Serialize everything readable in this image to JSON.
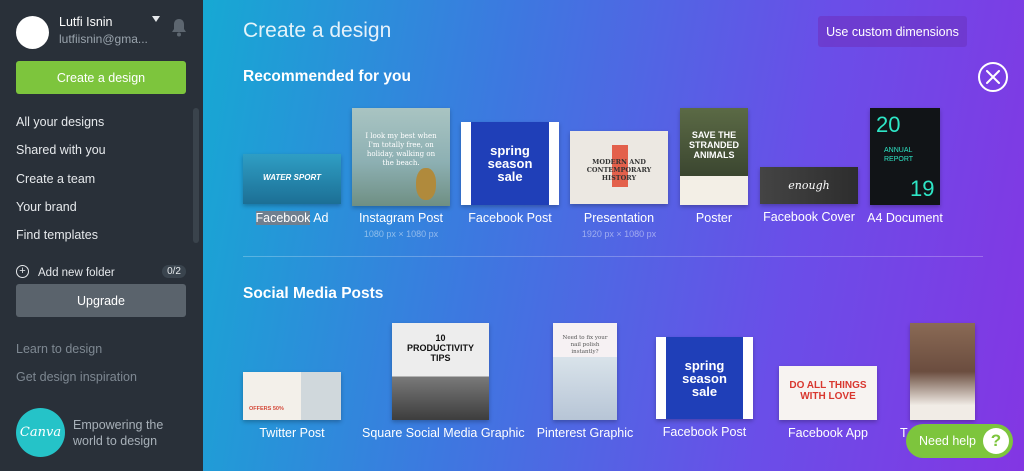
{
  "sidebar": {
    "user_name": "Lutfi Isnin",
    "user_email": "lutfiisnin@gma...",
    "create_label": "Create a design",
    "nav": [
      {
        "label": "All your designs"
      },
      {
        "label": "Shared with you"
      },
      {
        "label": "Create a team"
      },
      {
        "label": "Your brand"
      },
      {
        "label": "Find templates"
      }
    ],
    "add_folder": "Add new folder",
    "folder_count": "0/2",
    "upgrade_label": "Upgrade",
    "learn": "Learn to design",
    "inspiration": "Get design inspiration",
    "logo_text": "Canva",
    "tagline": "Empowering the world to design"
  },
  "main": {
    "title": "Create a design",
    "custom_dimensions": "Use custom dimensions",
    "recommended_title": "Recommended for you",
    "social_title": "Social Media Posts",
    "recommended": [
      {
        "label_hl": "Facebook",
        "label_rest": " Ad",
        "thumb_text": "WATER SPORT",
        "color": "#2a8fb5"
      },
      {
        "label": "Instagram Post",
        "dim": "1080 px × 1080 px",
        "thumb_text": "I look my best when I'm totally free, on holiday, walking on the beach.",
        "color": "#8fb3b6"
      },
      {
        "label": "Facebook Post",
        "thumb_text": "spring season sale",
        "color": "#1f3fb8"
      },
      {
        "label": "Presentation",
        "dim": "1920 px × 1080 px",
        "thumb_text": "MODERN AND CONTEMPORARY HISTORY",
        "color": "#e9e4dc"
      },
      {
        "label": "Poster",
        "thumb_text": "SAVE THE STRANDED ANIMALS",
        "color": "#4a5a3a"
      },
      {
        "label": "Facebook Cover",
        "thumb_text": "enough",
        "color": "#3b3b3b"
      },
      {
        "label": "A4 Document",
        "thumb_top": "20",
        "thumb_mid": "ANNUAL REPORT",
        "thumb_bottom": "19",
        "color": "#111417"
      }
    ],
    "social": [
      {
        "label": "Twitter Post",
        "thumb_text": "OFFERS 50%",
        "color": "#f3f0ea"
      },
      {
        "label": "Square Social Media Graphic",
        "thumb_text": "10 PRODUCTIVITY TIPS",
        "color": "#e9e9e9"
      },
      {
        "label": "Pinterest Graphic",
        "thumb_text": "Need to fix your nail polish instantly?",
        "color": "#f4eef0"
      },
      {
        "label": "Facebook Post",
        "thumb_text": "spring season sale",
        "color": "#1f3fb8"
      },
      {
        "label": "Facebook App",
        "thumb_text": "DO ALL THINGS WITH LOVE",
        "color": "#f7f3f1"
      },
      {
        "label": "T",
        "color": "#6b4d3f"
      }
    ]
  },
  "help": {
    "label": "Need help",
    "q": "?"
  },
  "colors": {
    "accent_green": "#7dc53d",
    "sidebar_bg": "#293039",
    "canva_teal": "#25c3c8"
  }
}
